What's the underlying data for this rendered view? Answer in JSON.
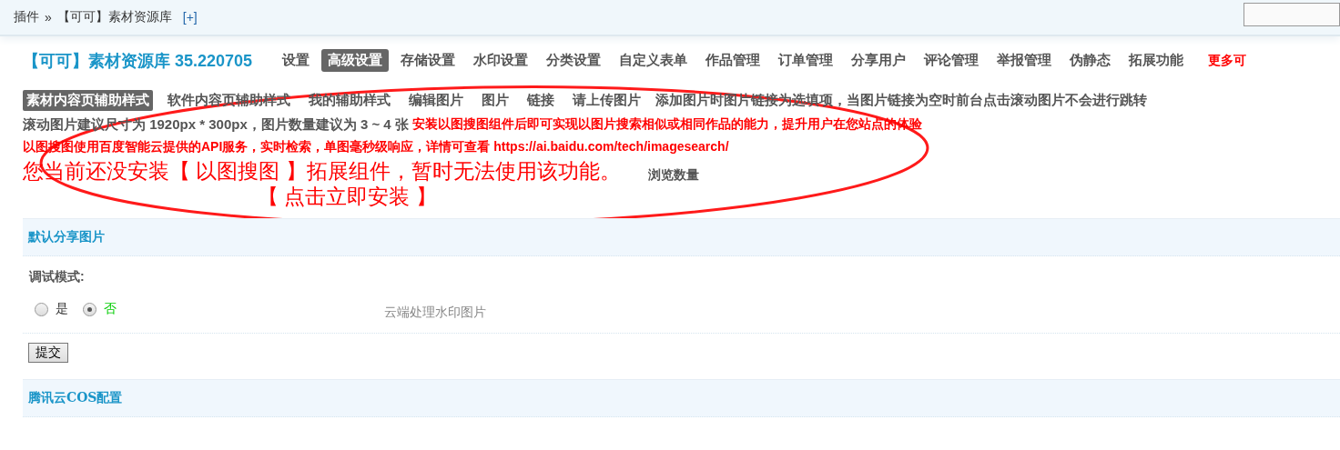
{
  "breadcrumb": {
    "items": [
      "插件",
      "【可可】素材资源库"
    ],
    "separator": "»",
    "add_link": "[+]"
  },
  "header": {
    "title": "【可可】素材资源库 35.220705",
    "tabs": [
      {
        "label": "设置",
        "selected": false
      },
      {
        "label": "高级设置",
        "selected": true
      },
      {
        "label": "存储设置",
        "selected": false
      },
      {
        "label": "水印设置",
        "selected": false
      },
      {
        "label": "分类设置",
        "selected": false
      },
      {
        "label": "自定义表单",
        "selected": false
      },
      {
        "label": "作品管理",
        "selected": false
      },
      {
        "label": "订单管理",
        "selected": false
      },
      {
        "label": "分享用户",
        "selected": false
      },
      {
        "label": "评论管理",
        "selected": false
      },
      {
        "label": "举报管理",
        "selected": false
      },
      {
        "label": "伪静态",
        "selected": false
      },
      {
        "label": "拓展功能",
        "selected": false
      }
    ],
    "more_link": "更多可"
  },
  "subtabs": [
    {
      "label": "素材内容页辅助样式",
      "selected": true
    },
    {
      "label": "软件内容页辅助样式",
      "selected": false
    },
    {
      "label": "我的辅助样式",
      "selected": false
    },
    {
      "label": "编辑图片",
      "selected": false
    },
    {
      "label": "图片",
      "selected": false
    },
    {
      "label": "链接",
      "selected": false
    },
    {
      "label": "请上传图片",
      "selected": false
    }
  ],
  "subtab_note": "添加图片时图片链接为选填项，当图片链接为空时前台点击滚动图片不会进行跳转",
  "info": {
    "size_hint": "滚动图片建议尺寸为 1920px * 300px，图片数量建议为 3 ~ 4 张",
    "install_hint": "安装以图搜图组件后即可实现以图片搜索相似或相同作品的能力，提升用户在您站点的体验",
    "api_hint": "以图搜图使用百度智能云提供的API服务，实时检索，单图毫秒级响应，详情可查看 https://ai.baidu.com/tech/imagesearch/",
    "notice": "您当前还没安装【 以图搜图 】拓展组件，暂时无法使用该功能。",
    "view_count_label": "浏览数量",
    "install_link": "【 点击立即安装 】"
  },
  "section": {
    "title": "默认分享图片",
    "setting_label": "调试模式:",
    "options": [
      {
        "label": "是",
        "selected": false
      },
      {
        "label": "否",
        "selected": true
      }
    ],
    "side_text": "云端处理水印图片"
  },
  "submit": "提交",
  "next_section": {
    "title": "腾讯云COS配置"
  }
}
